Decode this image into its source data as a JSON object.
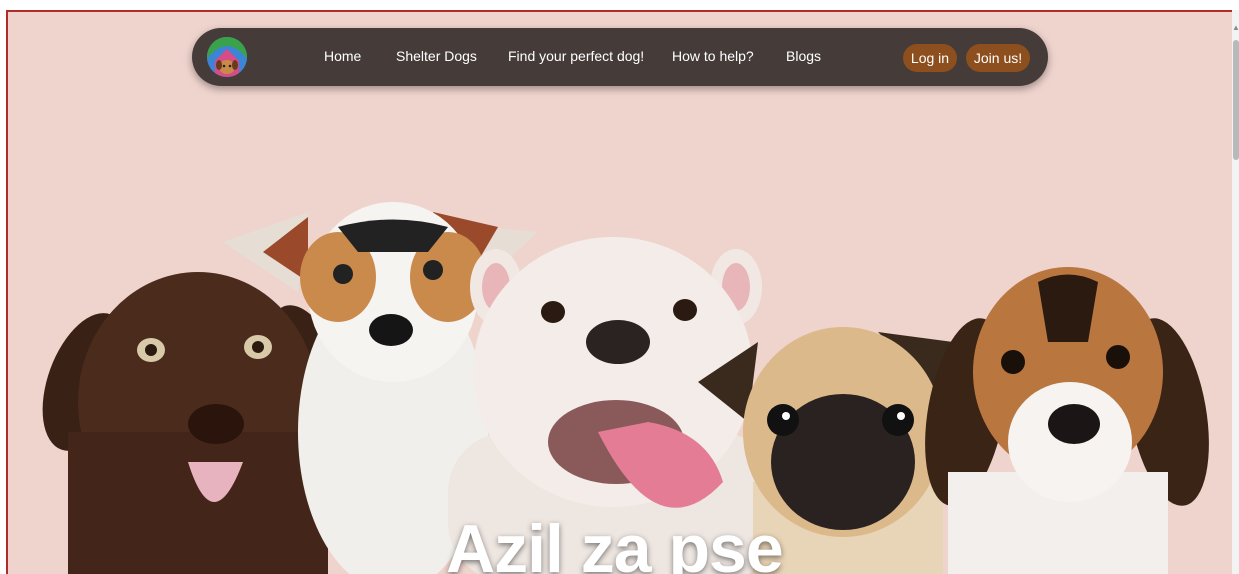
{
  "nav": {
    "links": [
      "Home",
      "Shelter Dogs",
      "Find your perfect dog!",
      "How to help?",
      "Blogs"
    ],
    "login_label": "Log in",
    "join_label": "Join us!"
  },
  "hero": {
    "title": "Azil za pse"
  },
  "colors": {
    "background": "#efd3cd",
    "navbar": "#453c39",
    "button": "#8d4f1d",
    "frame_border": "#b02c2c"
  }
}
